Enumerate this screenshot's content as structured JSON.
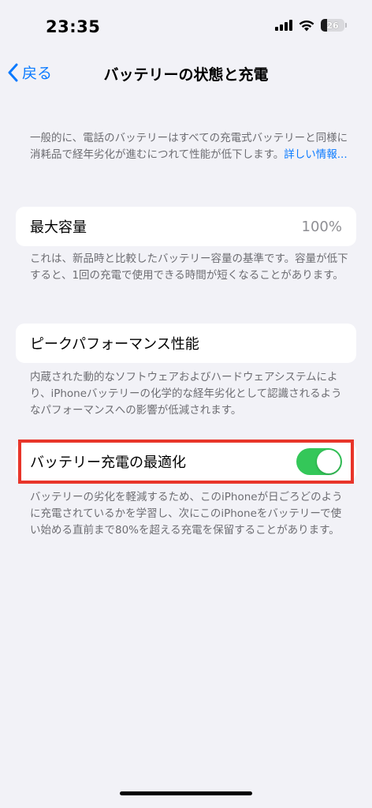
{
  "status_bar": {
    "time": "23:35",
    "battery_level": "26",
    "battery_fraction": 0.26
  },
  "nav": {
    "back_label": "戻る",
    "title": "バッテリーの状態と充電"
  },
  "intro": {
    "text": "一般的に、電話のバッテリーはすべての充電式バッテリーと同様に消耗品で経年劣化が進むにつれて性能が低下します。",
    "link": "詳しい情報..."
  },
  "max_capacity": {
    "label": "最大容量",
    "value": "100%",
    "footnote": "これは、新品時と比較したバッテリー容量の基準です。容量が低下すると、1回の充電で使用できる時間が短くなることがあります。"
  },
  "peak_performance": {
    "label": "ピークパフォーマンス性能",
    "footnote": "内蔵された動的なソフトウェアおよびハードウェアシステムにより、iPhoneバッテリーの化学的な経年劣化として認識されるようなパフォーマンスへの影響が低減されます。"
  },
  "optimized_charging": {
    "label": "バッテリー充電の最適化",
    "enabled": true,
    "footnote": "バッテリーの劣化を軽減するため、このiPhoneが日ごろどのように充電されているかを学習し、次にこのiPhoneをバッテリーで使い始める直前まで80%を超える充電を保留することがあります。"
  },
  "colors": {
    "accent": "#0a7aff",
    "toggle_on": "#34c759",
    "highlight": "#e8352a",
    "background": "#f2f2f7"
  }
}
